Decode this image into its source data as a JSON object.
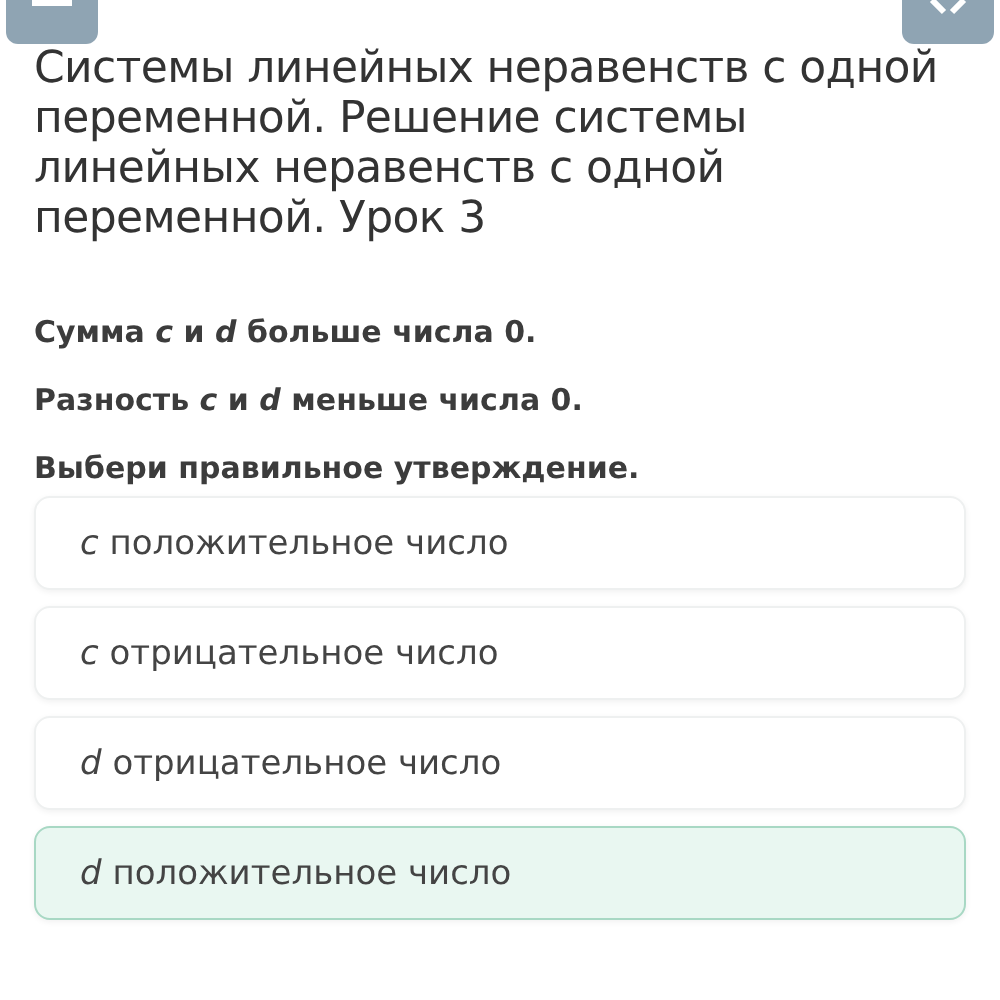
{
  "title": "Системы линейных неравенств с одной переменной. Решение системы линейных неравенств с одной переменной. Урок 3",
  "prompts": [
    "Сумма *c* и *d* больше числа 0.",
    "Разность *c* и *d* меньше числа 0.",
    "Выбери правильное утверждение."
  ],
  "options": [
    {
      "text": "*c* положительное число",
      "selected": false
    },
    {
      "text": "*c* отрицательное число",
      "selected": false
    },
    {
      "text": "*d* отрицательное число",
      "selected": false
    },
    {
      "text": "*d* положительное число",
      "selected": true
    }
  ]
}
